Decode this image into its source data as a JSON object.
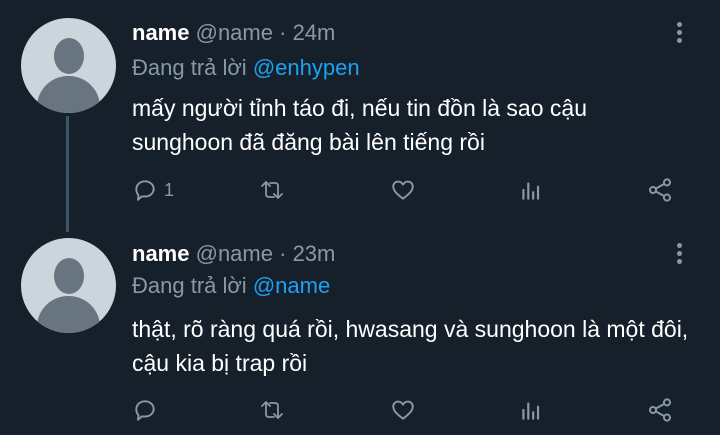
{
  "tweets": [
    {
      "name": "name",
      "handle": "@name",
      "separator": "·",
      "time": "24m",
      "reply_prefix": "Đang trả lời",
      "reply_to": "@enhypen",
      "text": "mấy người tỉnh táo đi, nếu tin đồn là sao cậu sunghoon đã đăng bài lên tiếng rồi",
      "reply_count": "1"
    },
    {
      "name": "name",
      "handle": "@name",
      "separator": "·",
      "time": "23m",
      "reply_prefix": "Đang trả lời",
      "reply_to": "@name",
      "text": "thật, rõ ràng quá rồi, hwasang và sunghoon là một đôi, cậu kia bị trap rồi",
      "reply_count": ""
    }
  ],
  "icons": {
    "reply": "reply-icon",
    "retweet": "retweet-icon",
    "like": "heart-icon",
    "analytics": "analytics-icon",
    "share": "share-icon",
    "more": "more-options-icon"
  },
  "colors": {
    "background": "#15202b",
    "secondary_text": "#8899a6",
    "accent": "#1da1f2",
    "thread_line": "#3d5466"
  }
}
